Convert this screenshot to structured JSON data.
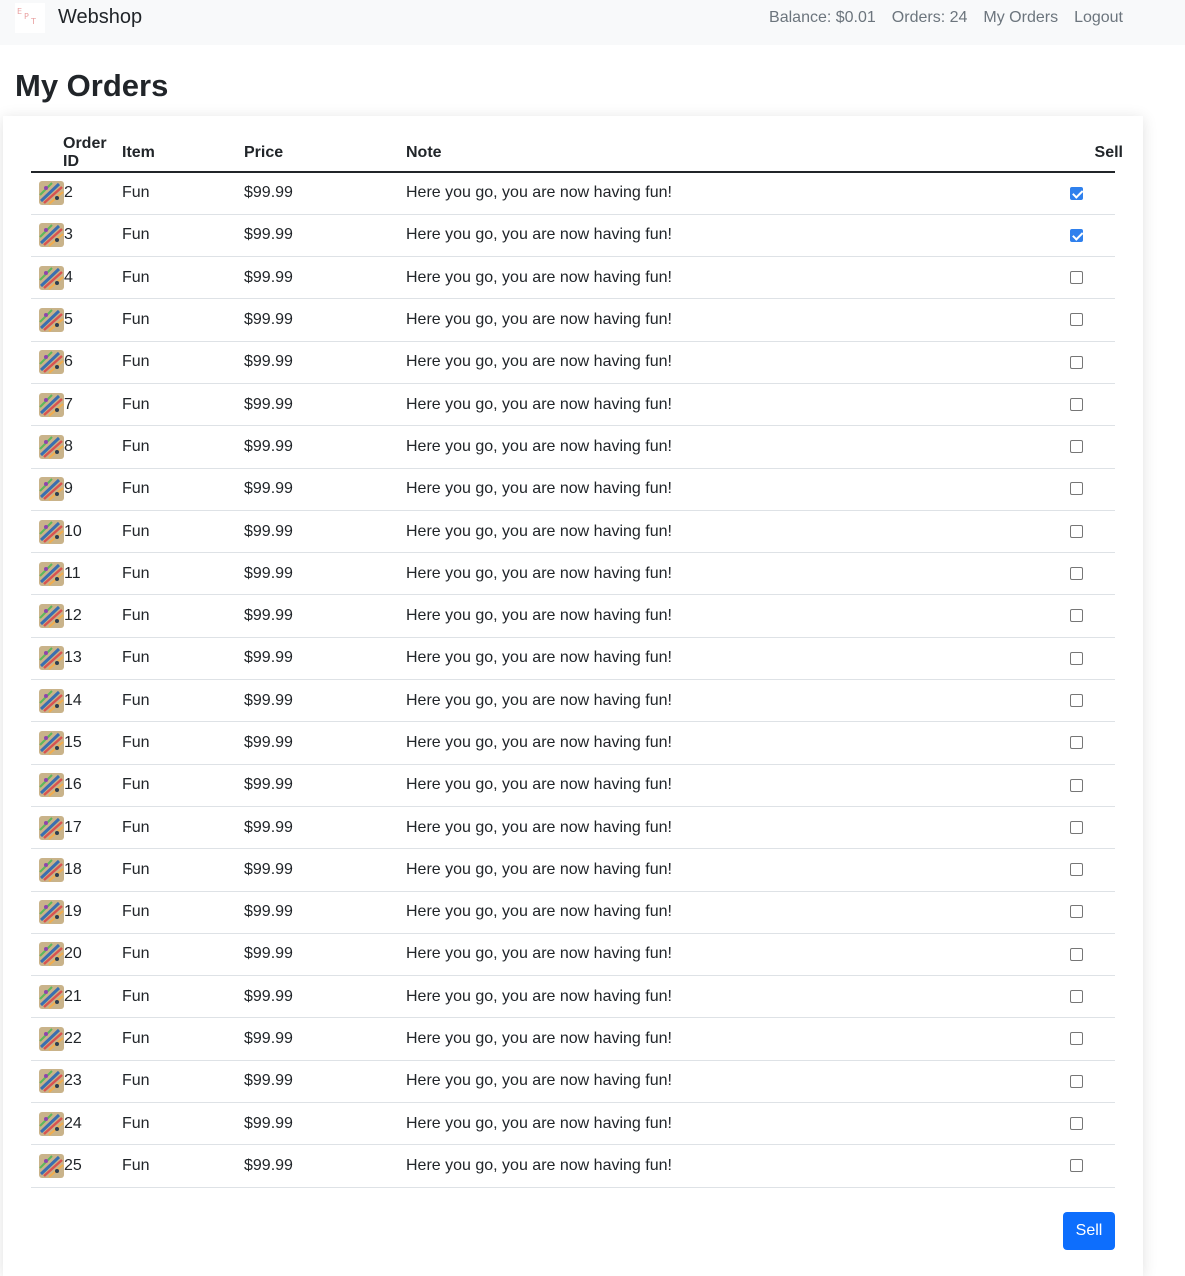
{
  "navbar": {
    "brand": "Webshop",
    "balance": "Balance: $0.01",
    "orders_count": "Orders: 24",
    "my_orders_link": "My Orders",
    "logout_link": "Logout"
  },
  "page": {
    "title": "My Orders"
  },
  "table": {
    "headers": {
      "order_id": "Order ID",
      "item": "Item",
      "price": "Price",
      "note": "Note",
      "sell": "Sell"
    },
    "rows": [
      {
        "id": "2",
        "item": "Fun",
        "price": "$99.99",
        "note": "Here you go, you are now having fun!",
        "checked": true
      },
      {
        "id": "3",
        "item": "Fun",
        "price": "$99.99",
        "note": "Here you go, you are now having fun!",
        "checked": true
      },
      {
        "id": "4",
        "item": "Fun",
        "price": "$99.99",
        "note": "Here you go, you are now having fun!",
        "checked": false
      },
      {
        "id": "5",
        "item": "Fun",
        "price": "$99.99",
        "note": "Here you go, you are now having fun!",
        "checked": false
      },
      {
        "id": "6",
        "item": "Fun",
        "price": "$99.99",
        "note": "Here you go, you are now having fun!",
        "checked": false
      },
      {
        "id": "7",
        "item": "Fun",
        "price": "$99.99",
        "note": "Here you go, you are now having fun!",
        "checked": false
      },
      {
        "id": "8",
        "item": "Fun",
        "price": "$99.99",
        "note": "Here you go, you are now having fun!",
        "checked": false
      },
      {
        "id": "9",
        "item": "Fun",
        "price": "$99.99",
        "note": "Here you go, you are now having fun!",
        "checked": false
      },
      {
        "id": "10",
        "item": "Fun",
        "price": "$99.99",
        "note": "Here you go, you are now having fun!",
        "checked": false
      },
      {
        "id": "11",
        "item": "Fun",
        "price": "$99.99",
        "note": "Here you go, you are now having fun!",
        "checked": false
      },
      {
        "id": "12",
        "item": "Fun",
        "price": "$99.99",
        "note": "Here you go, you are now having fun!",
        "checked": false
      },
      {
        "id": "13",
        "item": "Fun",
        "price": "$99.99",
        "note": "Here you go, you are now having fun!",
        "checked": false
      },
      {
        "id": "14",
        "item": "Fun",
        "price": "$99.99",
        "note": "Here you go, you are now having fun!",
        "checked": false
      },
      {
        "id": "15",
        "item": "Fun",
        "price": "$99.99",
        "note": "Here you go, you are now having fun!",
        "checked": false
      },
      {
        "id": "16",
        "item": "Fun",
        "price": "$99.99",
        "note": "Here you go, you are now having fun!",
        "checked": false
      },
      {
        "id": "17",
        "item": "Fun",
        "price": "$99.99",
        "note": "Here you go, you are now having fun!",
        "checked": false
      },
      {
        "id": "18",
        "item": "Fun",
        "price": "$99.99",
        "note": "Here you go, you are now having fun!",
        "checked": false
      },
      {
        "id": "19",
        "item": "Fun",
        "price": "$99.99",
        "note": "Here you go, you are now having fun!",
        "checked": false
      },
      {
        "id": "20",
        "item": "Fun",
        "price": "$99.99",
        "note": "Here you go, you are now having fun!",
        "checked": false
      },
      {
        "id": "21",
        "item": "Fun",
        "price": "$99.99",
        "note": "Here you go, you are now having fun!",
        "checked": false
      },
      {
        "id": "22",
        "item": "Fun",
        "price": "$99.99",
        "note": "Here you go, you are now having fun!",
        "checked": false
      },
      {
        "id": "23",
        "item": "Fun",
        "price": "$99.99",
        "note": "Here you go, you are now having fun!",
        "checked": false
      },
      {
        "id": "24",
        "item": "Fun",
        "price": "$99.99",
        "note": "Here you go, you are now having fun!",
        "checked": false
      },
      {
        "id": "25",
        "item": "Fun",
        "price": "$99.99",
        "note": "Here you go, you are now having fun!",
        "checked": false
      }
    ]
  },
  "actions": {
    "sell_button": "Sell"
  },
  "colors": {
    "primary": "#0d6efd",
    "checkbox_checked": "#2f80ed",
    "navbar_bg": "#f8f9fa",
    "nav_link": "#6c757d"
  },
  "icons": {
    "logo": "webshop-logo-icon",
    "item_thumbnail": "fun-item-thumbnail-icon"
  }
}
